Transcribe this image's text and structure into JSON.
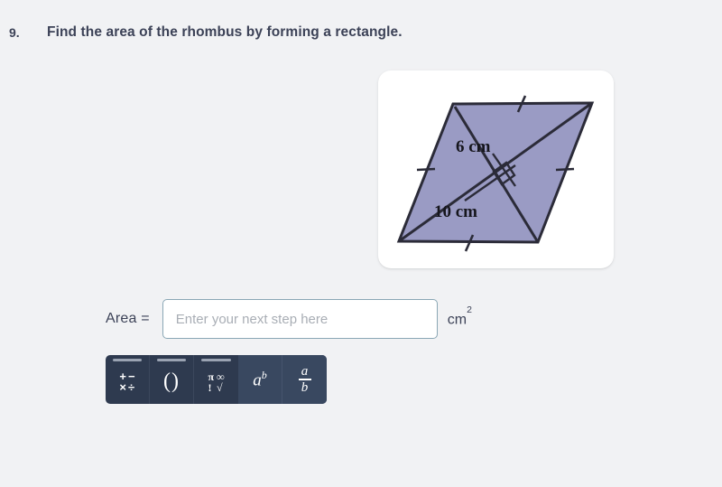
{
  "page": {
    "background_color": "#f1f2f4"
  },
  "question": {
    "number": "9.",
    "text": "Find the area of the rhombus by forming a rectangle."
  },
  "figure": {
    "shape": "rhombus",
    "fill_color": "#9a9bc4",
    "stroke_color": "#2b2b38",
    "card_background": "#ffffff",
    "labels": {
      "height": "6 cm",
      "base": "10 cm"
    },
    "annotations": {
      "right_angle": "right-angle-marker",
      "tick_marks": 4
    }
  },
  "answer": {
    "label": "Area  =",
    "input_value": "",
    "placeholder": "Enter your next step here",
    "unit_base": "cm",
    "unit_exponent": "2"
  },
  "math_toolbar": {
    "background_color": "#2e3a4f",
    "active_background_color": "#394860",
    "buttons": [
      {
        "name": "operators",
        "glyphs": [
          "+",
          "−",
          "×",
          "÷"
        ],
        "active": false
      },
      {
        "name": "parentheses",
        "glyphs": [
          "(",
          ")"
        ],
        "active": false
      },
      {
        "name": "functions",
        "glyphs": [
          "π",
          "∞",
          "!",
          "√"
        ],
        "active": false
      },
      {
        "name": "exponent",
        "base": "a",
        "exponent": "b",
        "active": true
      },
      {
        "name": "fraction",
        "numerator": "a",
        "denominator": "b",
        "active": true
      }
    ]
  }
}
